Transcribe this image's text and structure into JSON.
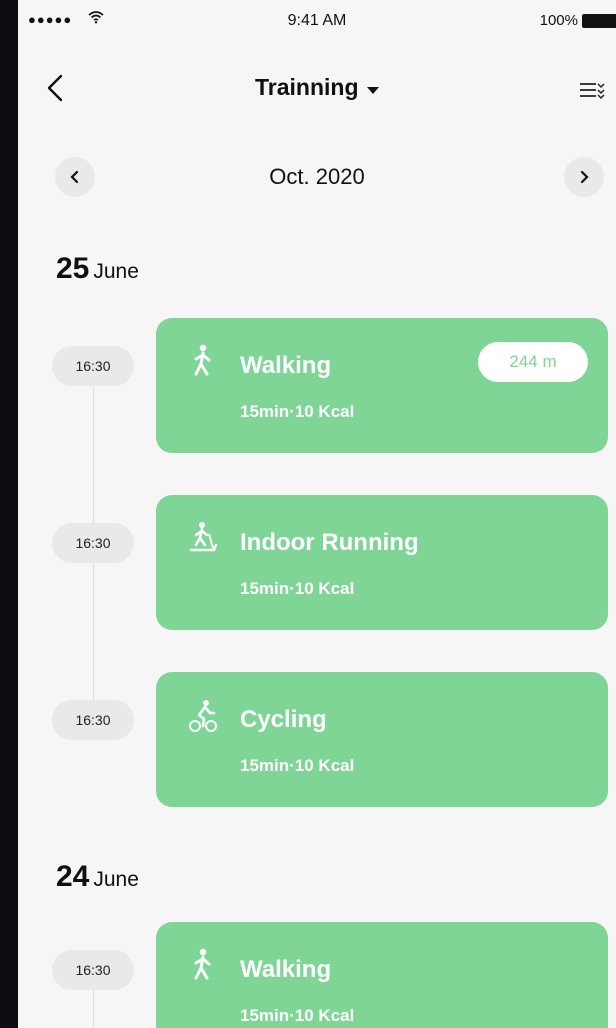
{
  "status_bar": {
    "signal": "●●●●●",
    "time": "9:41 AM",
    "battery": "100%"
  },
  "header": {
    "title": "Trainning"
  },
  "month_nav": {
    "label": "Oct. 2020"
  },
  "colors": {
    "card": "#7ed596",
    "background": "#f6f6f6",
    "pill": "#e9e9e9"
  },
  "days": [
    {
      "day": "25",
      "month": "June",
      "entries": [
        {
          "time": "16:30",
          "activity": "Walking",
          "icon": "walking-icon",
          "summary": "15min·10 Kcal",
          "distance": "244 m"
        },
        {
          "time": "16:30",
          "activity": "Indoor Running",
          "icon": "treadmill-icon",
          "summary": "15min·10 Kcal"
        },
        {
          "time": "16:30",
          "activity": "Cycling",
          "icon": "cycling-icon",
          "summary": "15min·10 Kcal"
        }
      ]
    },
    {
      "day": "24",
      "month": "June",
      "entries": [
        {
          "time": "16:30",
          "activity": "Walking",
          "icon": "walking-icon",
          "summary": "15min·10 Kcal"
        }
      ]
    }
  ]
}
